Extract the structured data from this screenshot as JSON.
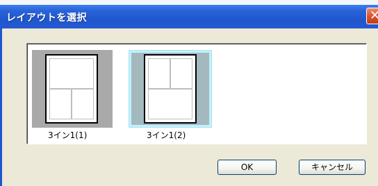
{
  "dialog": {
    "title": "レイアウトを選択",
    "close_symbol": "✕"
  },
  "layouts": [
    {
      "label": "3イン1(1)",
      "selected": false,
      "arrangement": "one-top-two-bottom"
    },
    {
      "label": "3イン1(2)",
      "selected": true,
      "arrangement": "two-top-one-bottom"
    }
  ],
  "buttons": {
    "ok_label": "OK",
    "cancel_label": "キャンセル"
  },
  "colors": {
    "titlebar": "#2458d0",
    "dialog_bg": "#ece9d8",
    "selection": "#9ee6f7",
    "close_button": "#d9562f"
  }
}
